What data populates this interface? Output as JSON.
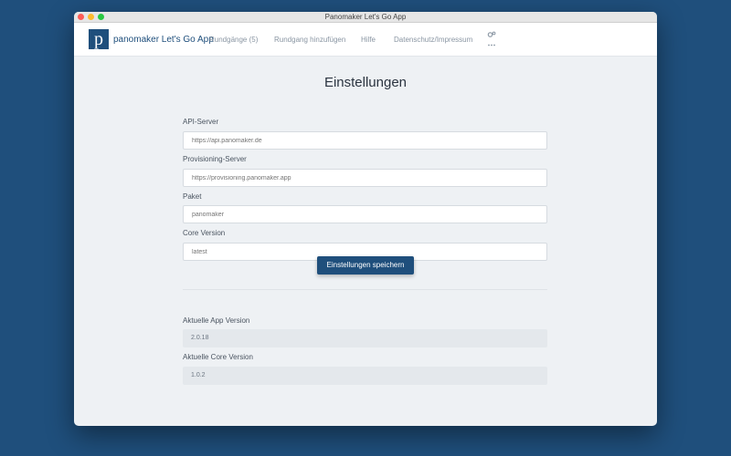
{
  "window": {
    "title": "Panomaker Let's Go App"
  },
  "navbar": {
    "logo_letter": "p",
    "brand": "panomaker Let's Go App",
    "links": [
      {
        "label": "Rundgänge (5)"
      },
      {
        "label": "Rundgang hinzufügen"
      },
      {
        "label": "Hilfe"
      },
      {
        "label": "Datenschutz/Impressum"
      }
    ],
    "settings_icon": "gear-icon"
  },
  "page": {
    "heading": "Einstellungen",
    "fields": [
      {
        "label": "API-Server",
        "placeholder": "https://api.panomaker.de"
      },
      {
        "label": "Provisioning-Server",
        "placeholder": "https://provisioning.panomaker.app"
      },
      {
        "label": "Paket",
        "placeholder": "panomaker"
      },
      {
        "label": "Core Version",
        "placeholder": "latest"
      }
    ],
    "save_label": "Einstellungen speichern",
    "info": [
      {
        "label": "Aktuelle App Version",
        "value": "2.0.18"
      },
      {
        "label": "Aktuelle Core Version",
        "value": "1.0.2"
      }
    ]
  },
  "colors": {
    "brand": "#1f4f7c",
    "background": "#1f4f7c",
    "content_bg": "#eef1f4"
  }
}
